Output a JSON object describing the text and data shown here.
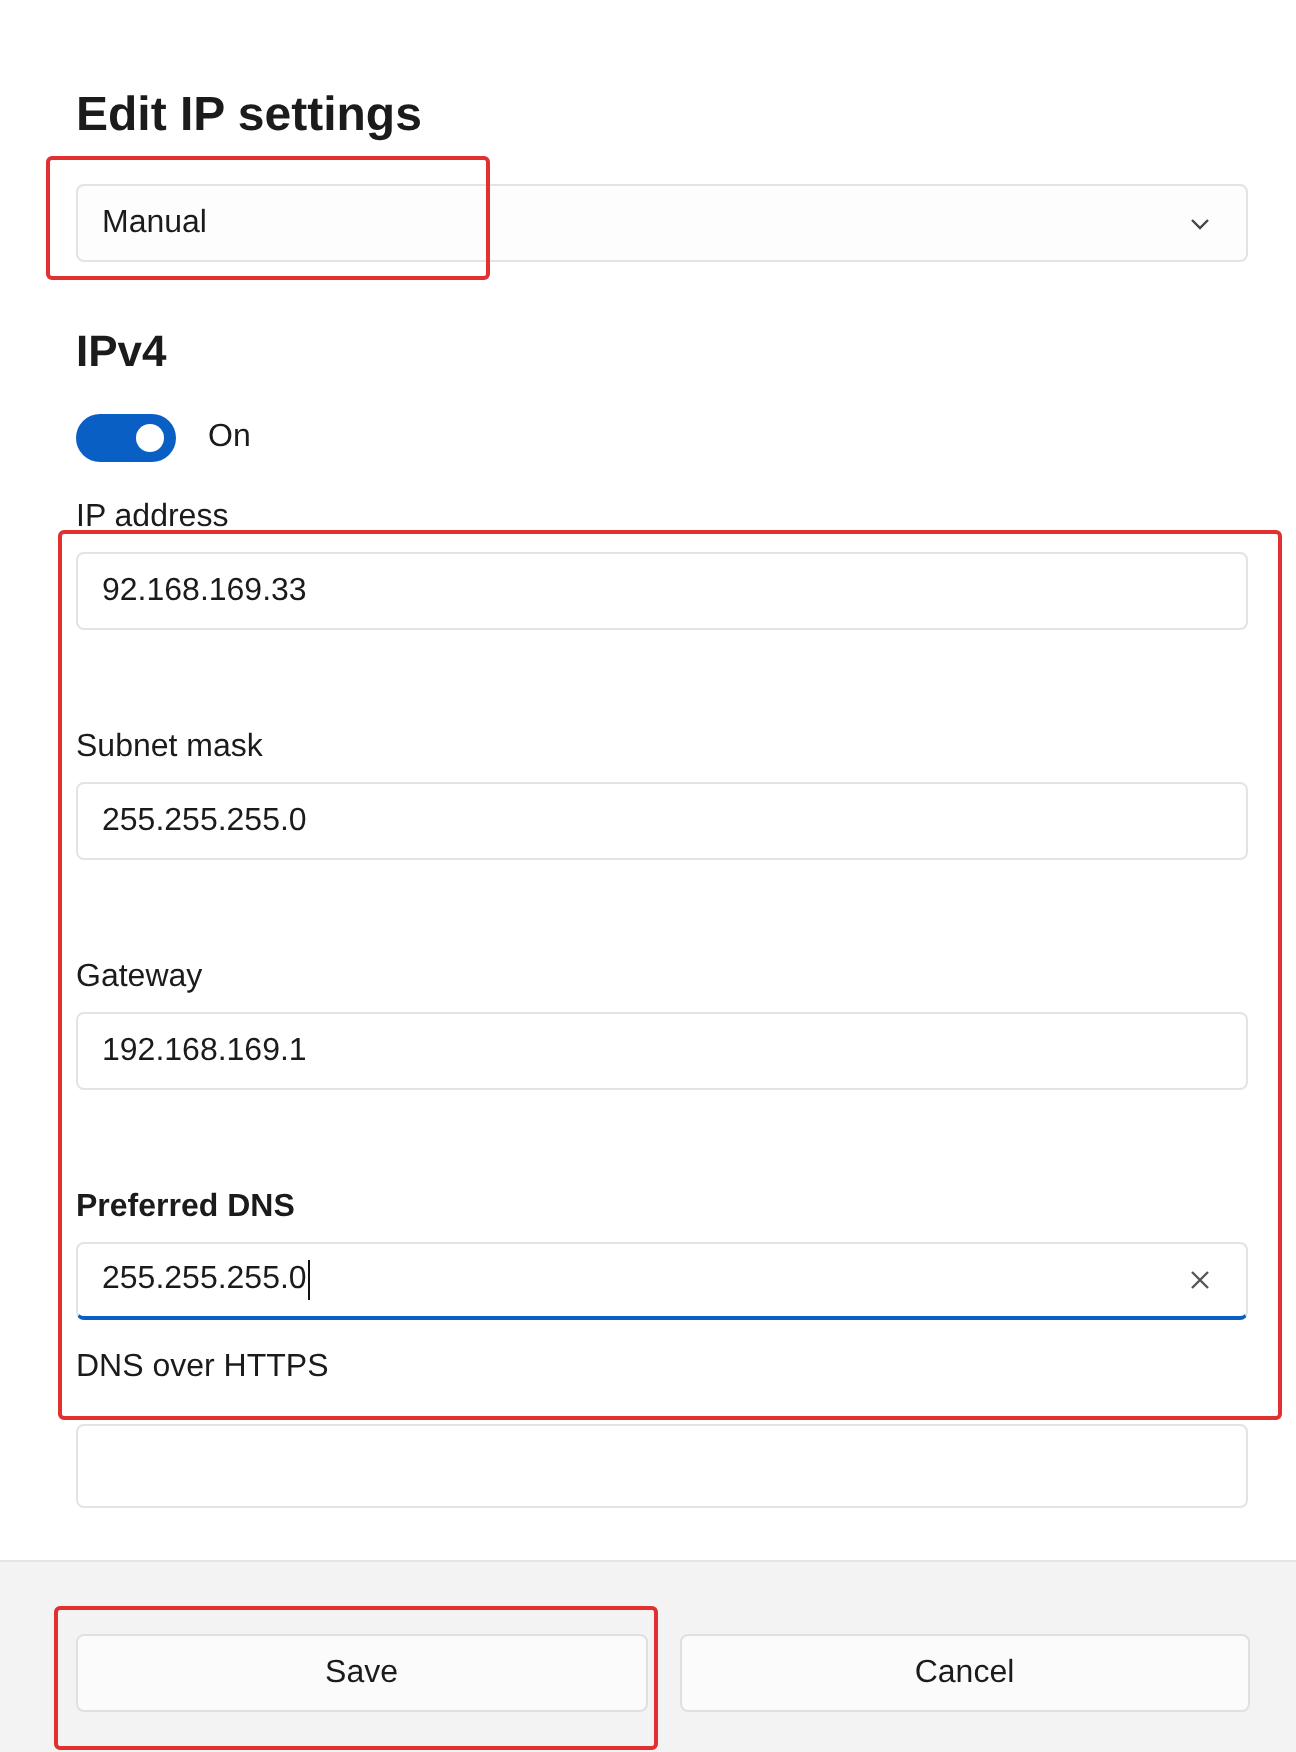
{
  "title": "Edit IP settings",
  "mode_dropdown": {
    "value": "Manual",
    "highlighted": true
  },
  "section": "IPv4",
  "toggle": {
    "on": true,
    "label": "On"
  },
  "address_group": {
    "highlighted": true,
    "fields": [
      {
        "label": "IP address",
        "value": "92.168.169.33",
        "focused": false
      },
      {
        "label": "Subnet mask",
        "value": "255.255.255.0",
        "focused": false
      },
      {
        "label": "Gateway",
        "value": "192.168.169.1",
        "focused": false
      },
      {
        "label": "Preferred DNS",
        "value": "255.255.255.0",
        "focused": true
      }
    ],
    "dns_over_https_label": "DNS over HTTPS"
  },
  "buttons": [
    {
      "label": "Save",
      "highlighted": true
    },
    {
      "label": "Cancel",
      "highlighted": false
    }
  ]
}
